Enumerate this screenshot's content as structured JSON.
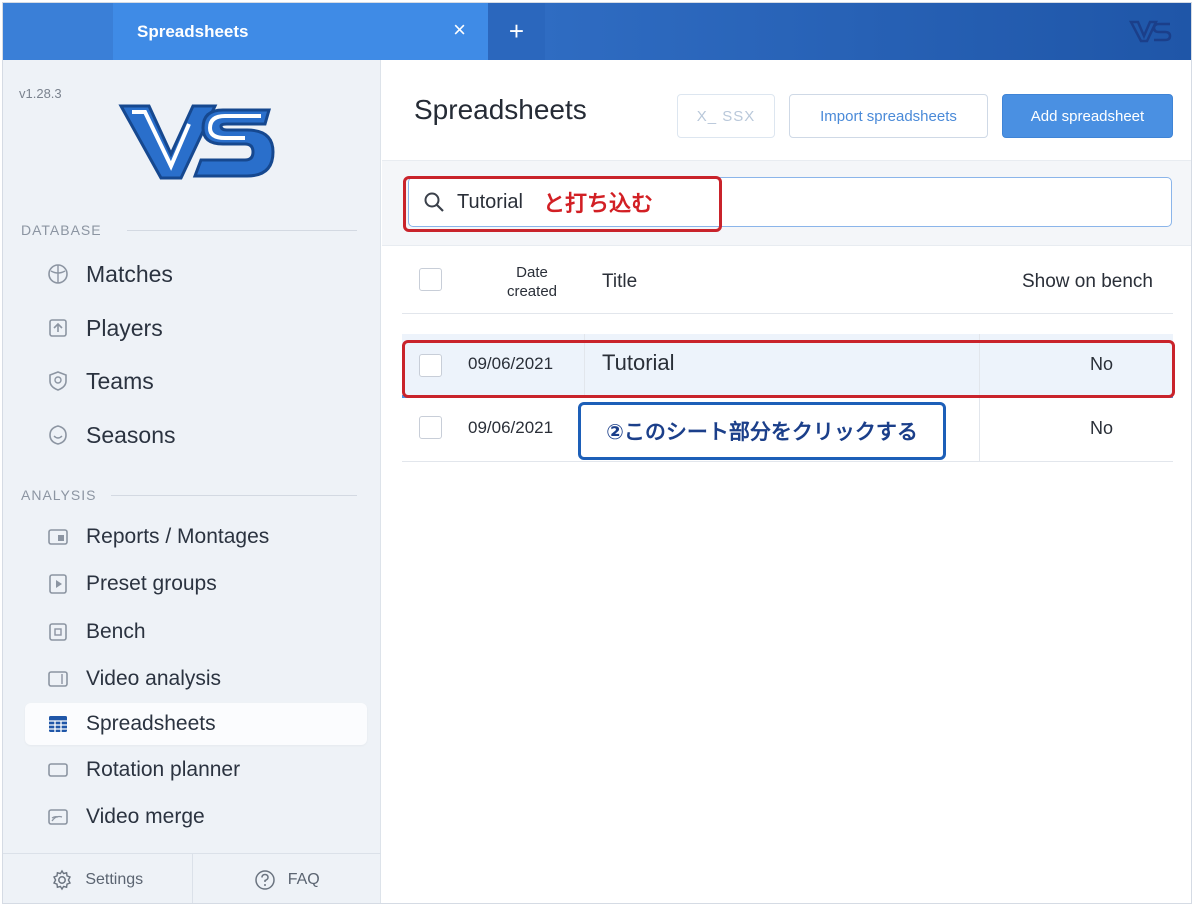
{
  "topbar": {
    "tab_title": "Spreadsheets",
    "close_glyph": "×",
    "add_glyph": "+"
  },
  "sidebar": {
    "version": "v1.28.3",
    "database_title": "DATABASE",
    "database_items": [
      {
        "label": "Matches",
        "icon": "ball-icon"
      },
      {
        "label": "Players",
        "icon": "player-icon"
      },
      {
        "label": "Teams",
        "icon": "shield-icon"
      },
      {
        "label": "Seasons",
        "icon": "calendar-icon"
      }
    ],
    "analysis_title": "ANALYSIS",
    "analysis_items": [
      {
        "label": "Reports / Montages",
        "icon": "report-icon"
      },
      {
        "label": "Preset groups",
        "icon": "preset-icon"
      },
      {
        "label": "Bench",
        "icon": "bench-icon"
      },
      {
        "label": "Video analysis",
        "icon": "video-icon"
      },
      {
        "label": "Spreadsheets",
        "icon": "spreadsheet-icon",
        "active": true
      },
      {
        "label": "Rotation planner",
        "icon": "rotation-icon"
      },
      {
        "label": "Video merge",
        "icon": "merge-icon"
      }
    ],
    "footer": {
      "settings": "Settings",
      "faq": "FAQ"
    }
  },
  "main": {
    "title": "Spreadsheets",
    "buttons": {
      "xlsx": "X_ SSX",
      "import": "Import spreadsheets",
      "add": "Add spreadsheet"
    },
    "search": {
      "value": "Tutorial",
      "annotation": "と打ち込む"
    },
    "table": {
      "headers": {
        "date_line1": "Date",
        "date_line2": "created",
        "title": "Title",
        "bench": "Show on bench"
      },
      "rows": [
        {
          "date": "09/06/2021",
          "title": "Tutorial",
          "bench": "No",
          "selected": true
        },
        {
          "date": "09/06/2021",
          "title": "",
          "bench": "No",
          "selected": false
        }
      ]
    },
    "row_annotation": "②このシート部分をクリックする"
  },
  "colors": {
    "accent": "#4a90e2",
    "annotation_red": "#c9232b",
    "annotation_blue": "#1d5fb8"
  }
}
